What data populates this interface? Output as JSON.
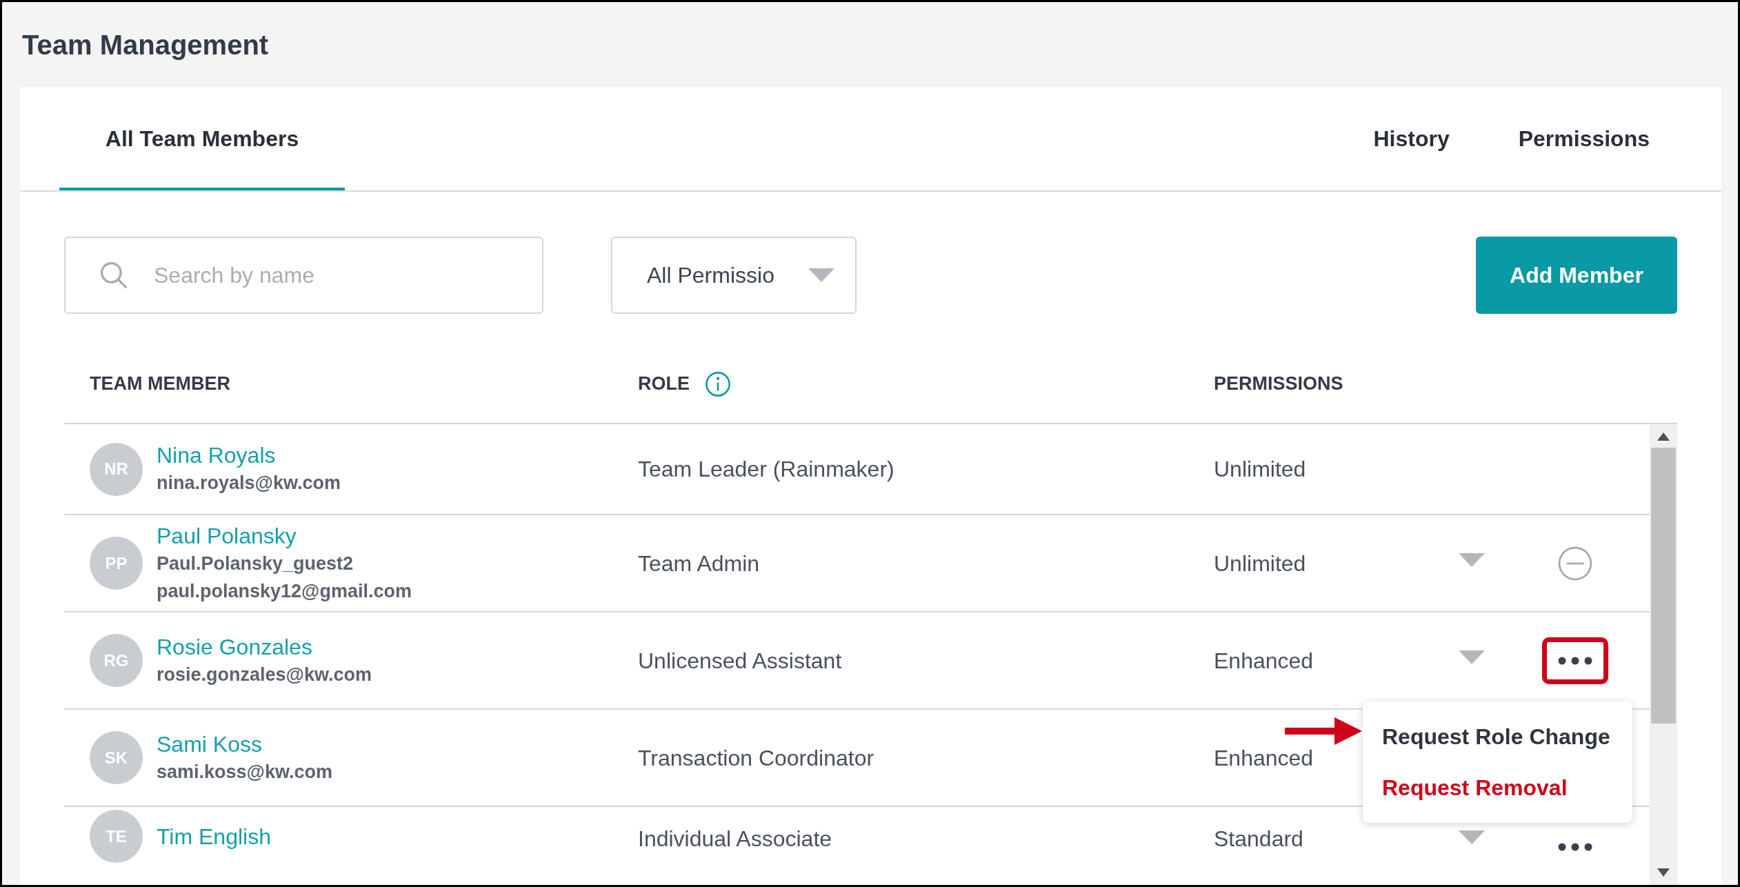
{
  "page": {
    "title": "Team Management"
  },
  "tabs": [
    {
      "label": "All Team Members",
      "selected": true
    },
    {
      "label": "History",
      "selected": false
    },
    {
      "label": "Permissions",
      "selected": false
    }
  ],
  "search": {
    "placeholder": "Search by name"
  },
  "filter": {
    "value": "All Permissio"
  },
  "add_button": "Add Member",
  "table": {
    "columns": [
      "TEAM MEMBER",
      "ROLE",
      "PERMISSIONS"
    ],
    "rows": [
      {
        "initials": "NR",
        "name": "Nina Royals",
        "details": [
          "nina.royals@kw.com"
        ],
        "role": "Team Leader (Rainmaker)",
        "permissions": "Unlimited",
        "caret": false,
        "kind": "plain",
        "highlighted": false
      },
      {
        "initials": "PP",
        "name": "Paul Polansky",
        "details": [
          "Paul.Polansky_guest2",
          "paul.polansky12@gmail.com"
        ],
        "role": "Team Admin",
        "permissions": "Unlimited",
        "caret": true,
        "kind": "removable",
        "highlighted": false
      },
      {
        "initials": "RG",
        "name": "Rosie Gonzales",
        "details": [
          "rosie.gonzales@kw.com"
        ],
        "role": "Unlicensed Assistant",
        "permissions": "Enhanced",
        "caret": true,
        "kind": "options",
        "highlighted": true
      },
      {
        "initials": "SK",
        "name": "Sami Koss",
        "details": [
          "sami.koss@kw.com"
        ],
        "role": "Transaction Coordinator",
        "permissions": "Enhanced",
        "kind": "plain"
      },
      {
        "initials": "TE",
        "name": "Tim English",
        "details": [],
        "role": "Individual Associate",
        "permissions": "Standard",
        "caret": true,
        "kind": "options",
        "highlighted": false
      }
    ]
  },
  "menu": {
    "pointer_arrow": true,
    "items": [
      {
        "label": "Request Role Change",
        "kind": "normal"
      },
      {
        "label": "Request Removal",
        "kind": "danger"
      }
    ]
  }
}
